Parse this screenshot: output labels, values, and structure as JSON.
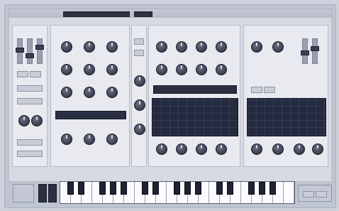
{
  "window": {
    "title": ""
  },
  "header": {
    "preset_lcd_1": "",
    "preset_lcd_2": ""
  },
  "sections": {
    "left": {
      "labels": [
        "",
        "",
        "",
        "",
        "",
        ""
      ]
    },
    "osc": {
      "labels": [
        "",
        "",
        "",
        "",
        "",
        "",
        "",
        ""
      ]
    },
    "filter": {
      "labels": [
        "",
        "",
        "",
        "",
        "",
        "",
        "",
        ""
      ]
    },
    "mod": {
      "labels": [
        "",
        "",
        "",
        "",
        "",
        ""
      ]
    }
  },
  "displays": {
    "left_display_label": "",
    "right_display_label": ""
  },
  "keyboard": {
    "label": ""
  },
  "colors": {
    "panel": "#d7dae3",
    "section": "#e8eaf0",
    "display": "#242a3f",
    "knob_dark": "#24283a"
  }
}
